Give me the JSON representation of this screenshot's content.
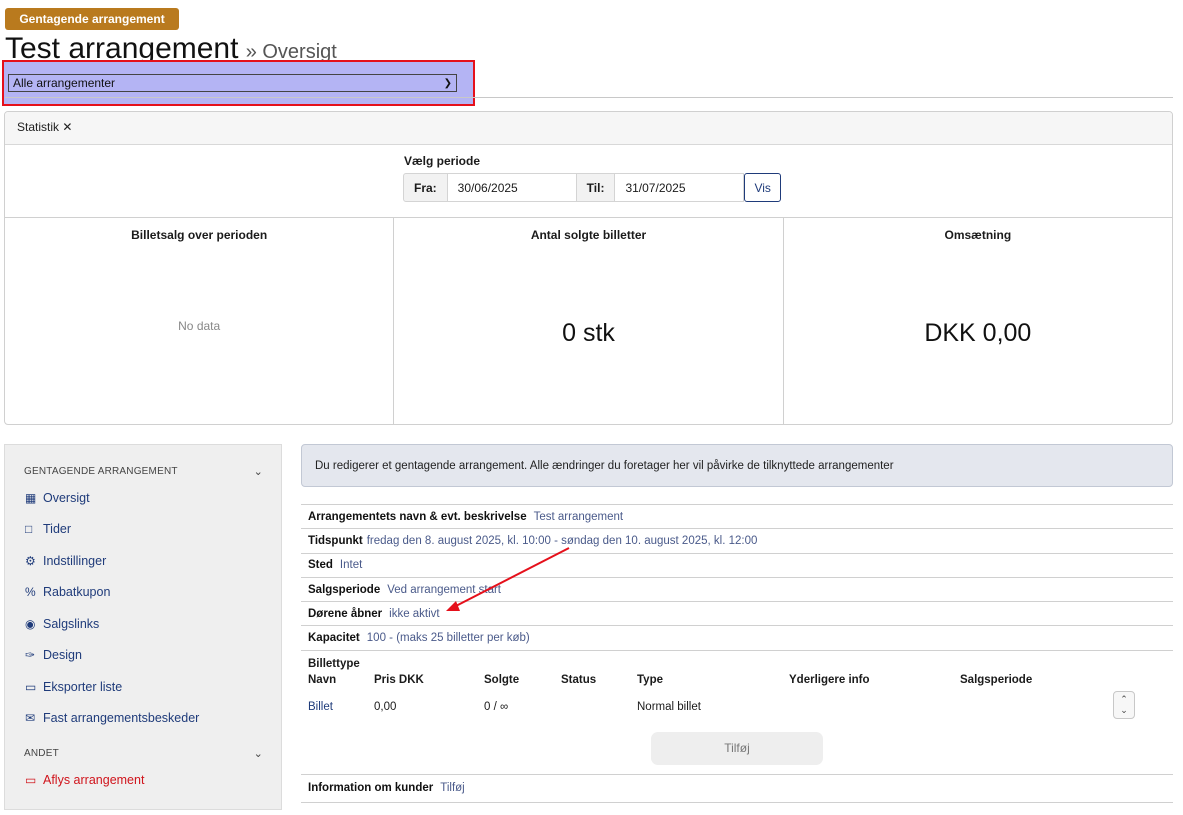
{
  "header": {
    "badge": "Gentagende arrangement",
    "title": "Test arrangement",
    "subtitle": "» Oversigt",
    "event_select": {
      "selected": "Alle arrangementer"
    }
  },
  "stats": {
    "tab_label": "Statistik ✕",
    "period_label": "Vælg periode",
    "from_label": "Fra:",
    "from_value": "30/06/2025",
    "to_label": "Til:",
    "to_value": "31/07/2025",
    "show_button": "Vis",
    "columns": [
      {
        "title": "Billetsalg over perioden",
        "value": "No data"
      },
      {
        "title": "Antal solgte billetter",
        "value": "0 stk"
      },
      {
        "title": "Omsætning",
        "value": "DKK 0,00"
      }
    ]
  },
  "sidebar": {
    "section1": "GENTAGENDE ARRANGEMENT",
    "items": [
      {
        "label": "Oversigt",
        "icon": "table-icon"
      },
      {
        "label": "Tider",
        "icon": "calendar-icon"
      },
      {
        "label": "Indstillinger",
        "icon": "gear-icon"
      },
      {
        "label": "Rabatkupon",
        "icon": "percent-icon"
      },
      {
        "label": "Salgslinks",
        "icon": "globe-icon"
      },
      {
        "label": "Design",
        "icon": "brush-icon"
      },
      {
        "label": "Eksporter liste",
        "icon": "folder-icon"
      },
      {
        "label": "Fast arrangementsbeskeder",
        "icon": "envelope-icon"
      }
    ],
    "section2": "ANDET",
    "danger_item": {
      "label": "Aflys arrangement",
      "icon": "folder-open-icon"
    }
  },
  "notice": "Du redigerer et gentagende arrangement. Alle ændringer du foretager her vil påvirke de tilknyttede arrangementer",
  "details": {
    "rows": [
      {
        "label": "Arrangementets navn & evt. beskrivelse",
        "value": "Test arrangement"
      },
      {
        "label": "Tidspunkt",
        "value": "fredag den 8. august 2025, kl. 10:00 - søndag den 10. august 2025, kl. 12:00"
      },
      {
        "label": "Sted",
        "value": "Intet"
      },
      {
        "label": "Salgsperiode",
        "value": "Ved arrangement start"
      },
      {
        "label": "Dørene åbner",
        "value": "ikke aktivt"
      },
      {
        "label": "Kapacitet",
        "value": "100 - (maks 25 billetter per køb)"
      }
    ],
    "tickets": {
      "label": "Billettype",
      "headers": [
        "Navn",
        "Pris DKK",
        "Solgte",
        "Status",
        "Type",
        "Yderligere info",
        "Salgsperiode"
      ],
      "row": {
        "name": "Billet",
        "price": "0,00",
        "sold": "0 / ∞",
        "status": "",
        "type": "Normal billet",
        "info": "",
        "period": ""
      },
      "add_button": "Tilføj"
    },
    "customer_info": {
      "label": "Information om kunder",
      "value": "Tilføj"
    }
  },
  "colors": {
    "badge": "#b97a1e",
    "highlight_border": "#e5101b",
    "select_bg": "#b4b4f4",
    "link": "#1f3b7a",
    "danger": "#d0141c",
    "annotation_arrow": "#e5101b"
  }
}
